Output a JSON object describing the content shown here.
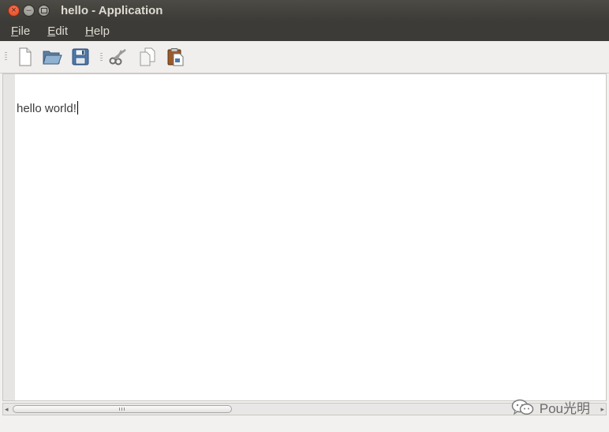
{
  "window": {
    "title": "hello - Application",
    "controls": [
      "close",
      "minimize",
      "maximize"
    ]
  },
  "menubar": {
    "items": [
      {
        "mnemonic": "F",
        "rest": "ile"
      },
      {
        "mnemonic": "E",
        "rest": "dit"
      },
      {
        "mnemonic": "H",
        "rest": "elp"
      }
    ]
  },
  "toolbar": {
    "icons": [
      "new-file-icon",
      "open-folder-icon",
      "save-icon",
      "cut-icon",
      "copy-icon",
      "paste-icon"
    ]
  },
  "editor": {
    "text": "hello world!"
  },
  "watermark": {
    "text": "Pou光明",
    "icon": "wechat-icon"
  },
  "colors": {
    "titlebar": "#3c3b37",
    "title_text": "#dfdbd2",
    "close_button": "#e9562a",
    "editor_background": "#ffffff"
  }
}
